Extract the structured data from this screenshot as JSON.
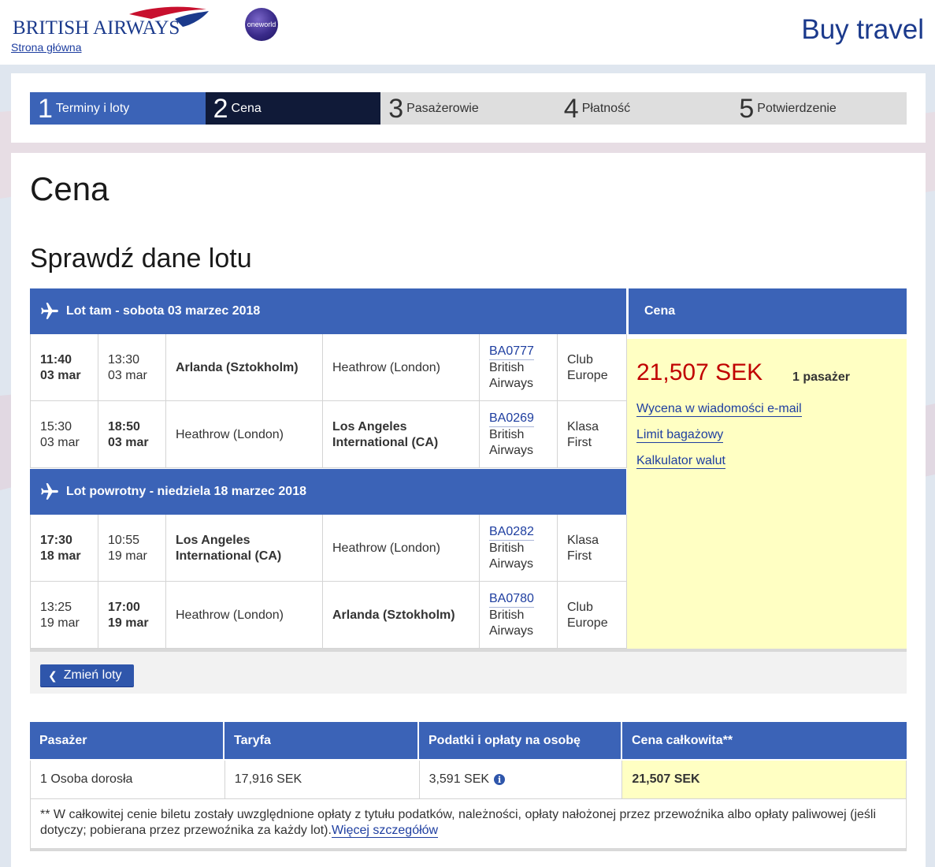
{
  "header": {
    "brand": "BRITISH AIRWAYS",
    "home_link": "Strona główna",
    "alliance_logo": "oneworld",
    "site_title": "Buy travel"
  },
  "steps": [
    {
      "num": "1",
      "label": "Terminy i loty",
      "state": "done"
    },
    {
      "num": "2",
      "label": "Cena",
      "state": "active"
    },
    {
      "num": "3",
      "label": "Pasażerowie",
      "state": "upcoming"
    },
    {
      "num": "4",
      "label": "Płatność",
      "state": "upcoming"
    },
    {
      "num": "5",
      "label": "Potwierdzenie",
      "state": "upcoming"
    }
  ],
  "page": {
    "title": "Cena",
    "section_title": "Sprawdź dane lotu"
  },
  "outbound": {
    "header": "Lot tam - sobota 03 marzec 2018",
    "segments": [
      {
        "dep_time": "11:40",
        "dep_date": "03 mar",
        "arr_time": "13:30",
        "arr_date": "03 mar",
        "from": "Arlanda (Sztokholm)",
        "to": "Heathrow (London)",
        "flight": "BA0777",
        "carrier": "British Airways",
        "cabin": "Club Europe"
      },
      {
        "dep_time": "15:30",
        "dep_date": "03 mar",
        "arr_time": "18:50",
        "arr_date": "03 mar",
        "from": "Heathrow (London)",
        "to": "Los Angeles International (CA)",
        "flight": "BA0269",
        "carrier": "British Airways",
        "cabin": "Klasa First"
      }
    ]
  },
  "inbound": {
    "header": "Lot powrotny - niedziela 18 marzec 2018",
    "segments": [
      {
        "dep_time": "17:30",
        "dep_date": "18 mar",
        "arr_time": "10:55",
        "arr_date": "19 mar",
        "from": "Los Angeles International (CA)",
        "to": "Heathrow (London)",
        "flight": "BA0282",
        "carrier": "British Airways",
        "cabin": "Klasa First"
      },
      {
        "dep_time": "13:25",
        "dep_date": "19 mar",
        "arr_time": "17:00",
        "arr_date": "19 mar",
        "from": "Heathrow (London)",
        "to": "Arlanda (Sztokholm)",
        "flight": "BA0780",
        "carrier": "British Airways",
        "cabin": "Club Europe"
      }
    ]
  },
  "price": {
    "header": "Cena",
    "amount": "21,507 SEK",
    "passengers": "1 pasażer",
    "links": [
      "Wycena w wiadomości e-mail",
      "Limit bagażowy",
      "Kalkulator walut"
    ]
  },
  "change_flights_label": "Zmień loty",
  "fare_table": {
    "headers": [
      "Pasażer",
      "Taryfa",
      "Podatki i opłaty na osobę",
      "Cena całkowita**"
    ],
    "row": [
      "1 Osoba dorosła",
      "17,916 SEK",
      "3,591 SEK",
      "21,507 SEK"
    ],
    "note": "** W całkowitej cenie biletu zostały uwzględnione opłaty z tytułu podatków, należności, opłaty nałożonej przez przewoźnika albo opłaty paliwowej (jeśli dotyczy; pobierana przez przewoźnika za każdy lot).",
    "note_link": "Więcej szczegółów"
  },
  "colors": {
    "brand_blue": "#3b63b7",
    "active_step": "#101a38",
    "price_red": "#c00000",
    "price_bg": "#ffffc3"
  }
}
